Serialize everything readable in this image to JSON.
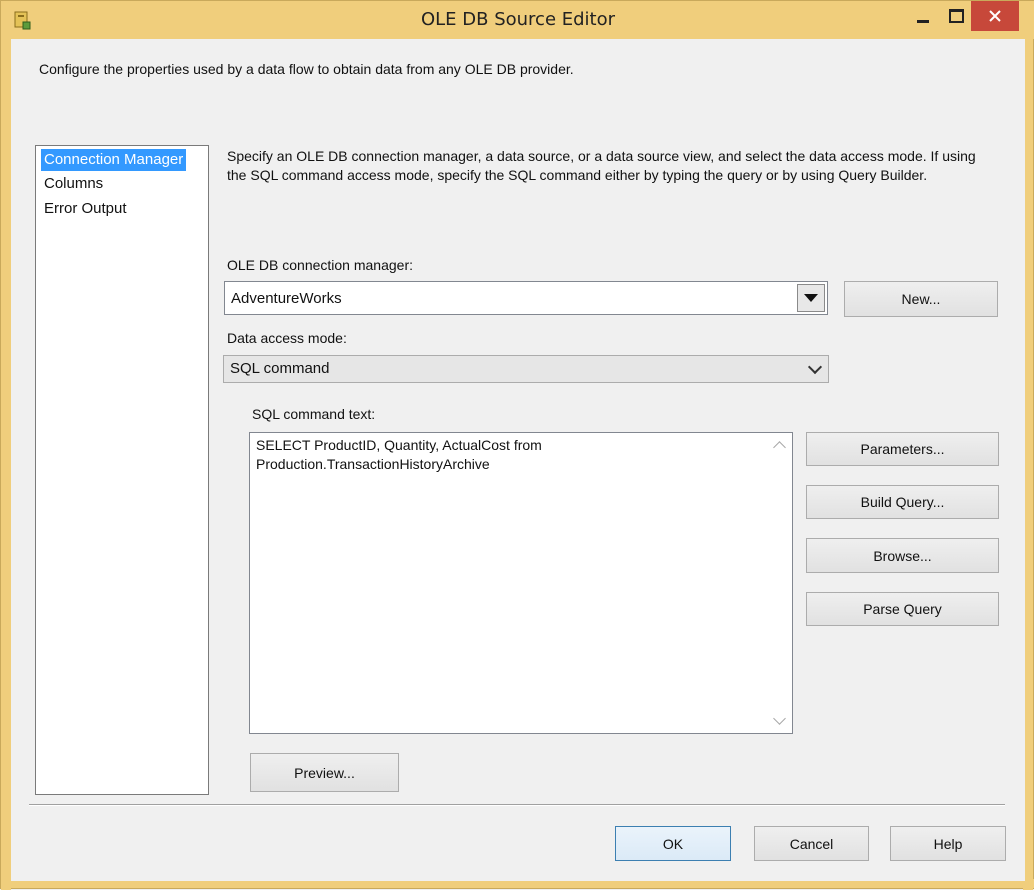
{
  "window": {
    "title": "OLE DB Source Editor",
    "icon": "ssis-package-icon"
  },
  "description": "Configure the properties used by a data flow to obtain data from any OLE DB provider.",
  "nav": {
    "items": [
      {
        "label": "Connection Manager",
        "selected": true
      },
      {
        "label": "Columns",
        "selected": false
      },
      {
        "label": "Error Output",
        "selected": false
      }
    ]
  },
  "main": {
    "instructions_line1": "Specify an OLE DB connection manager, a data source, or a data source view, and select the data access mode. If using",
    "instructions_line2": "the SQL command access mode, specify the SQL command either by typing the query or by using Query Builder.",
    "connection_label": "OLE DB connection manager:",
    "connection_value": "AdventureWorks",
    "new_button": "New...",
    "access_mode_label": "Data access mode:",
    "access_mode_value": "SQL command",
    "sql_label": "SQL command text:",
    "sql_text": "SELECT ProductID, Quantity, ActualCost from\nProduction.TransactionHistoryArchive",
    "parameters_button": "Parameters...",
    "build_query_button": "Build Query...",
    "browse_button": "Browse...",
    "parse_query_button": "Parse Query",
    "preview_button": "Preview..."
  },
  "footer": {
    "ok": "OK",
    "cancel": "Cancel",
    "help": "Help"
  },
  "colors": {
    "title_bar": "#f0ce7c",
    "close_button": "#c7483a",
    "selection": "#3399ff"
  }
}
